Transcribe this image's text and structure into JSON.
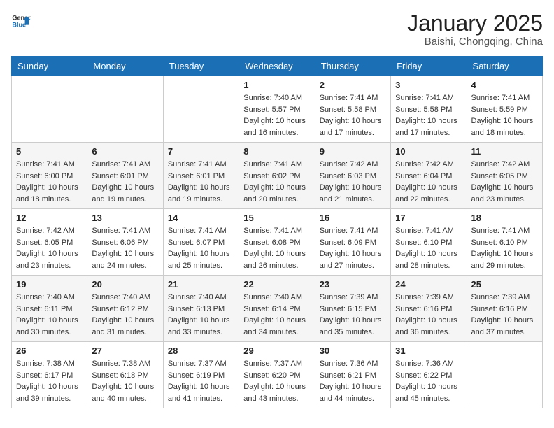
{
  "header": {
    "logo_general": "General",
    "logo_blue": "Blue",
    "month": "January 2025",
    "location": "Baishi, Chongqing, China"
  },
  "weekdays": [
    "Sunday",
    "Monday",
    "Tuesday",
    "Wednesday",
    "Thursday",
    "Friday",
    "Saturday"
  ],
  "weeks": [
    [
      {
        "day": "",
        "sunrise": "",
        "sunset": "",
        "daylight": ""
      },
      {
        "day": "",
        "sunrise": "",
        "sunset": "",
        "daylight": ""
      },
      {
        "day": "",
        "sunrise": "",
        "sunset": "",
        "daylight": ""
      },
      {
        "day": "1",
        "sunrise": "Sunrise: 7:40 AM",
        "sunset": "Sunset: 5:57 PM",
        "daylight": "Daylight: 10 hours and 16 minutes."
      },
      {
        "day": "2",
        "sunrise": "Sunrise: 7:41 AM",
        "sunset": "Sunset: 5:58 PM",
        "daylight": "Daylight: 10 hours and 17 minutes."
      },
      {
        "day": "3",
        "sunrise": "Sunrise: 7:41 AM",
        "sunset": "Sunset: 5:58 PM",
        "daylight": "Daylight: 10 hours and 17 minutes."
      },
      {
        "day": "4",
        "sunrise": "Sunrise: 7:41 AM",
        "sunset": "Sunset: 5:59 PM",
        "daylight": "Daylight: 10 hours and 18 minutes."
      }
    ],
    [
      {
        "day": "5",
        "sunrise": "Sunrise: 7:41 AM",
        "sunset": "Sunset: 6:00 PM",
        "daylight": "Daylight: 10 hours and 18 minutes."
      },
      {
        "day": "6",
        "sunrise": "Sunrise: 7:41 AM",
        "sunset": "Sunset: 6:01 PM",
        "daylight": "Daylight: 10 hours and 19 minutes."
      },
      {
        "day": "7",
        "sunrise": "Sunrise: 7:41 AM",
        "sunset": "Sunset: 6:01 PM",
        "daylight": "Daylight: 10 hours and 19 minutes."
      },
      {
        "day": "8",
        "sunrise": "Sunrise: 7:41 AM",
        "sunset": "Sunset: 6:02 PM",
        "daylight": "Daylight: 10 hours and 20 minutes."
      },
      {
        "day": "9",
        "sunrise": "Sunrise: 7:42 AM",
        "sunset": "Sunset: 6:03 PM",
        "daylight": "Daylight: 10 hours and 21 minutes."
      },
      {
        "day": "10",
        "sunrise": "Sunrise: 7:42 AM",
        "sunset": "Sunset: 6:04 PM",
        "daylight": "Daylight: 10 hours and 22 minutes."
      },
      {
        "day": "11",
        "sunrise": "Sunrise: 7:42 AM",
        "sunset": "Sunset: 6:05 PM",
        "daylight": "Daylight: 10 hours and 23 minutes."
      }
    ],
    [
      {
        "day": "12",
        "sunrise": "Sunrise: 7:42 AM",
        "sunset": "Sunset: 6:05 PM",
        "daylight": "Daylight: 10 hours and 23 minutes."
      },
      {
        "day": "13",
        "sunrise": "Sunrise: 7:41 AM",
        "sunset": "Sunset: 6:06 PM",
        "daylight": "Daylight: 10 hours and 24 minutes."
      },
      {
        "day": "14",
        "sunrise": "Sunrise: 7:41 AM",
        "sunset": "Sunset: 6:07 PM",
        "daylight": "Daylight: 10 hours and 25 minutes."
      },
      {
        "day": "15",
        "sunrise": "Sunrise: 7:41 AM",
        "sunset": "Sunset: 6:08 PM",
        "daylight": "Daylight: 10 hours and 26 minutes."
      },
      {
        "day": "16",
        "sunrise": "Sunrise: 7:41 AM",
        "sunset": "Sunset: 6:09 PM",
        "daylight": "Daylight: 10 hours and 27 minutes."
      },
      {
        "day": "17",
        "sunrise": "Sunrise: 7:41 AM",
        "sunset": "Sunset: 6:10 PM",
        "daylight": "Daylight: 10 hours and 28 minutes."
      },
      {
        "day": "18",
        "sunrise": "Sunrise: 7:41 AM",
        "sunset": "Sunset: 6:10 PM",
        "daylight": "Daylight: 10 hours and 29 minutes."
      }
    ],
    [
      {
        "day": "19",
        "sunrise": "Sunrise: 7:40 AM",
        "sunset": "Sunset: 6:11 PM",
        "daylight": "Daylight: 10 hours and 30 minutes."
      },
      {
        "day": "20",
        "sunrise": "Sunrise: 7:40 AM",
        "sunset": "Sunset: 6:12 PM",
        "daylight": "Daylight: 10 hours and 31 minutes."
      },
      {
        "day": "21",
        "sunrise": "Sunrise: 7:40 AM",
        "sunset": "Sunset: 6:13 PM",
        "daylight": "Daylight: 10 hours and 33 minutes."
      },
      {
        "day": "22",
        "sunrise": "Sunrise: 7:40 AM",
        "sunset": "Sunset: 6:14 PM",
        "daylight": "Daylight: 10 hours and 34 minutes."
      },
      {
        "day": "23",
        "sunrise": "Sunrise: 7:39 AM",
        "sunset": "Sunset: 6:15 PM",
        "daylight": "Daylight: 10 hours and 35 minutes."
      },
      {
        "day": "24",
        "sunrise": "Sunrise: 7:39 AM",
        "sunset": "Sunset: 6:16 PM",
        "daylight": "Daylight: 10 hours and 36 minutes."
      },
      {
        "day": "25",
        "sunrise": "Sunrise: 7:39 AM",
        "sunset": "Sunset: 6:16 PM",
        "daylight": "Daylight: 10 hours and 37 minutes."
      }
    ],
    [
      {
        "day": "26",
        "sunrise": "Sunrise: 7:38 AM",
        "sunset": "Sunset: 6:17 PM",
        "daylight": "Daylight: 10 hours and 39 minutes."
      },
      {
        "day": "27",
        "sunrise": "Sunrise: 7:38 AM",
        "sunset": "Sunset: 6:18 PM",
        "daylight": "Daylight: 10 hours and 40 minutes."
      },
      {
        "day": "28",
        "sunrise": "Sunrise: 7:37 AM",
        "sunset": "Sunset: 6:19 PM",
        "daylight": "Daylight: 10 hours and 41 minutes."
      },
      {
        "day": "29",
        "sunrise": "Sunrise: 7:37 AM",
        "sunset": "Sunset: 6:20 PM",
        "daylight": "Daylight: 10 hours and 43 minutes."
      },
      {
        "day": "30",
        "sunrise": "Sunrise: 7:36 AM",
        "sunset": "Sunset: 6:21 PM",
        "daylight": "Daylight: 10 hours and 44 minutes."
      },
      {
        "day": "31",
        "sunrise": "Sunrise: 7:36 AM",
        "sunset": "Sunset: 6:22 PM",
        "daylight": "Daylight: 10 hours and 45 minutes."
      },
      {
        "day": "",
        "sunrise": "",
        "sunset": "",
        "daylight": ""
      }
    ]
  ]
}
